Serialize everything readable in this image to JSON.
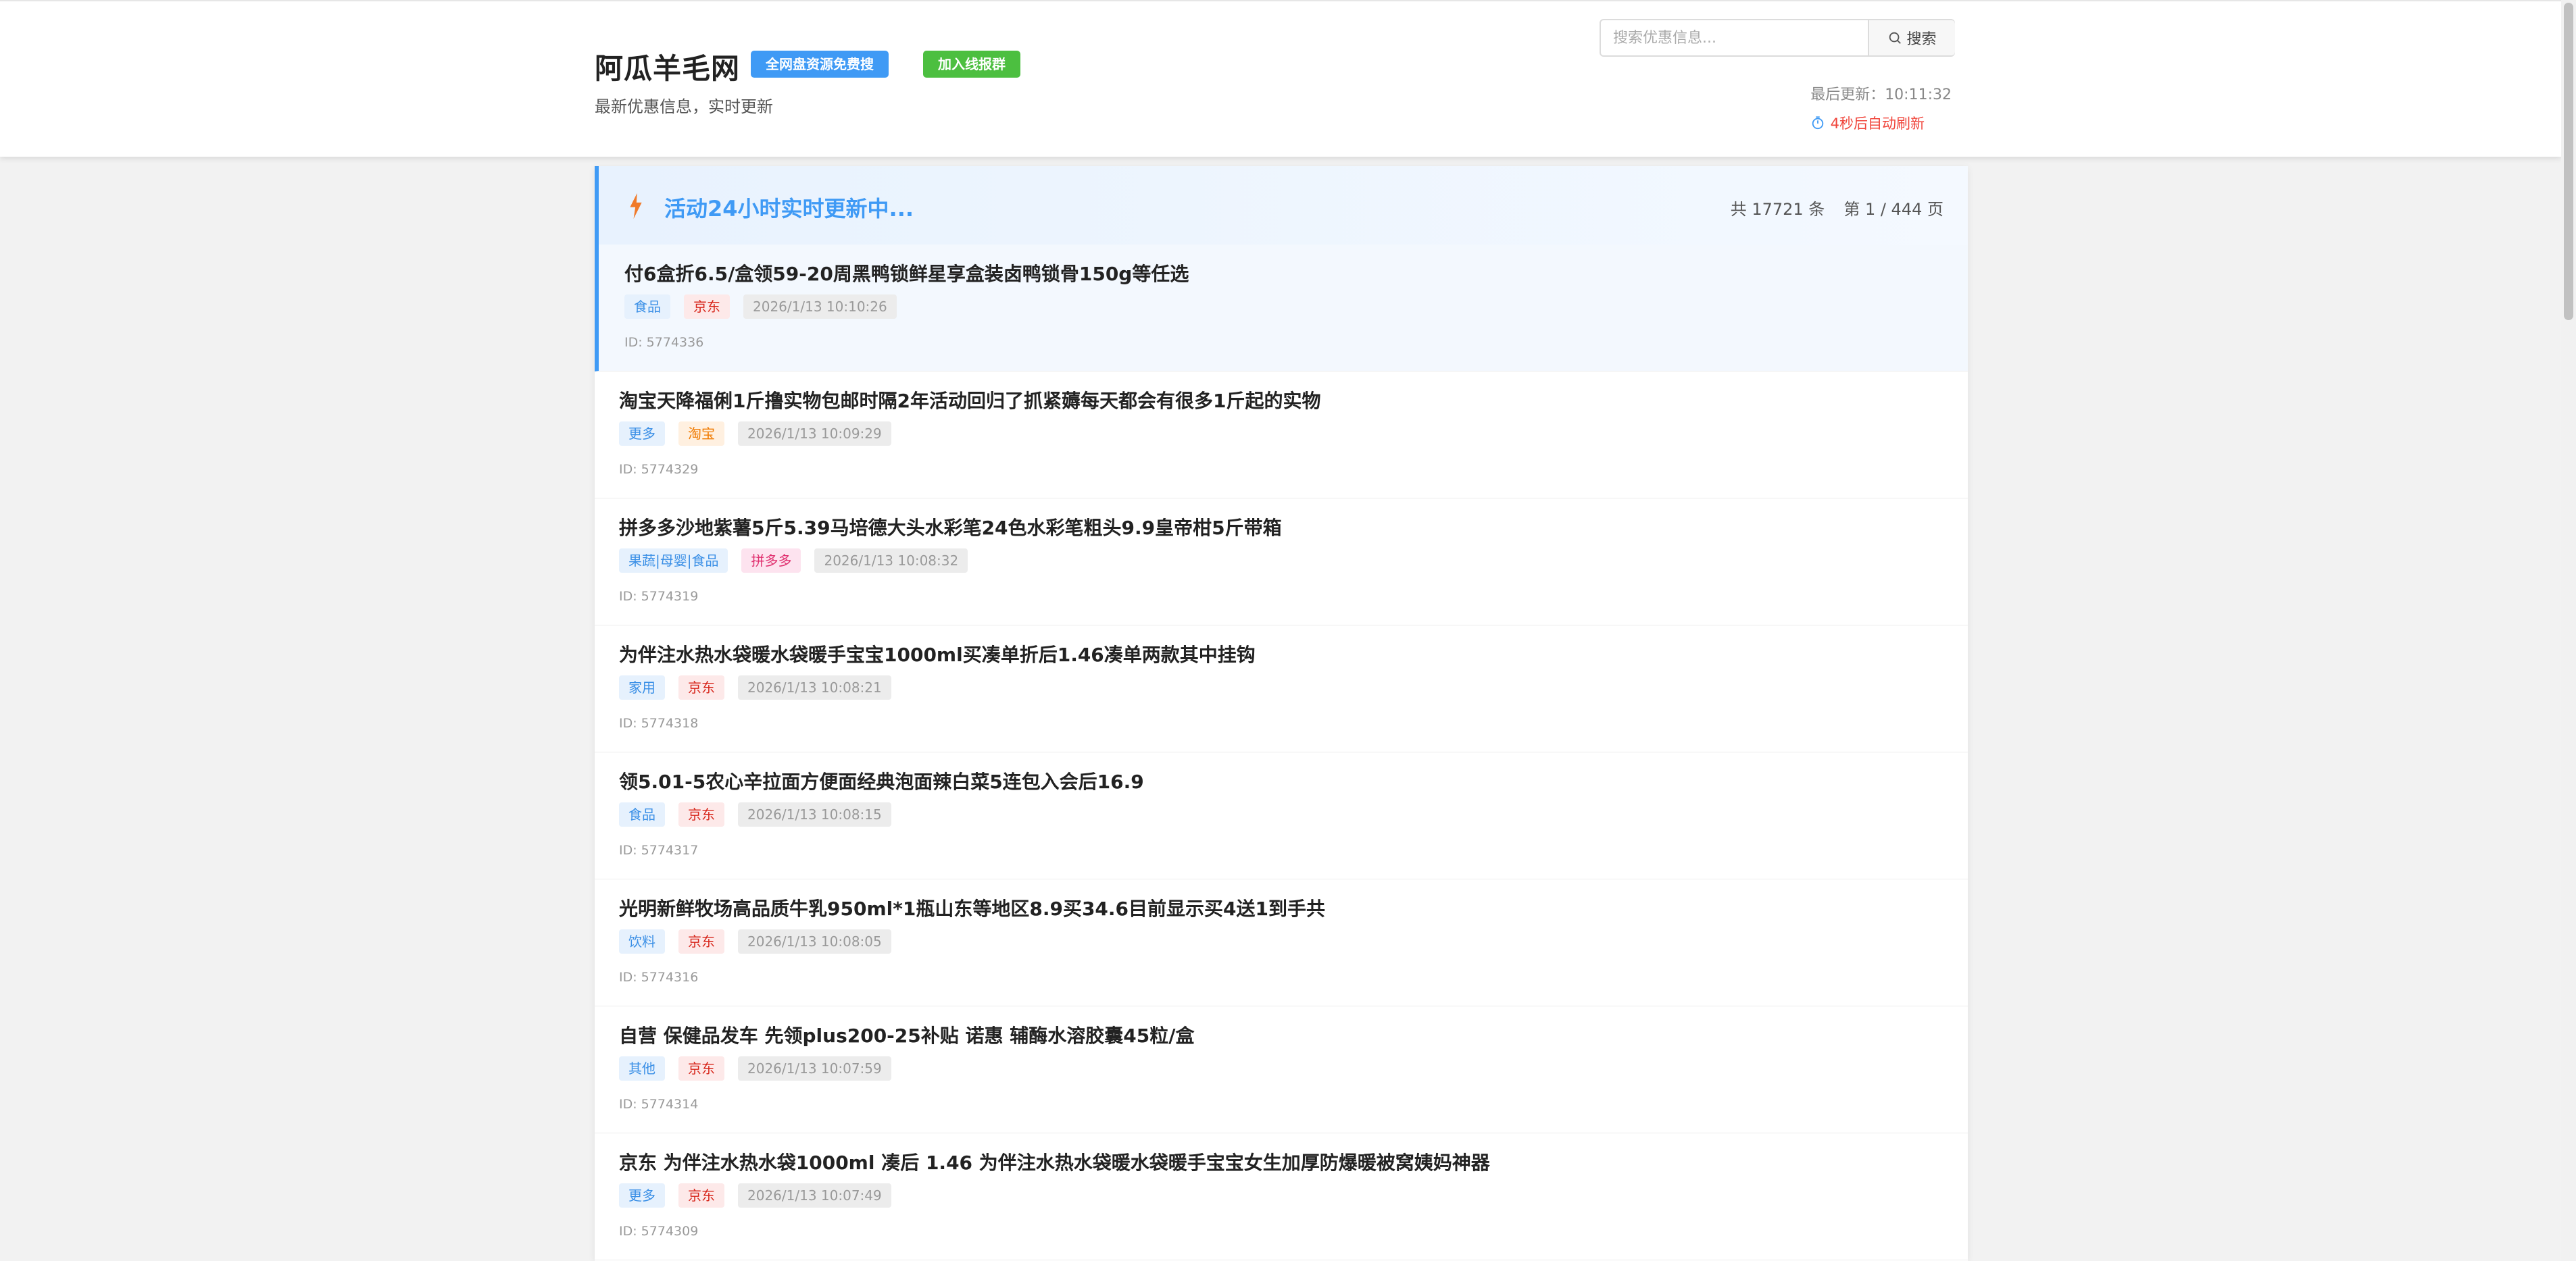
{
  "header": {
    "title": "阿瓜羊毛网",
    "badge_search": "全网盘资源免费搜",
    "badge_group": "加入线报群",
    "subtitle": "最新优惠信息，实时更新",
    "search_placeholder": "搜索优惠信息...",
    "search_button": "搜索",
    "last_updated": "最后更新：10:11:32",
    "auto_refresh": "4秒后自动刷新"
  },
  "list": {
    "title": "活动24小时实时更新中...",
    "total": "共 17721 条",
    "page": "第 1 / 444 页"
  },
  "items": [
    {
      "title": "付6盒折6.5/盒领59-20周黑鸭锁鲜星享盒装卤鸭锁骨150g等任选",
      "category": "食品",
      "platform": "京东",
      "time": "2026/1/13 10:10:26",
      "id": "ID: 5774336"
    },
    {
      "title": "淘宝天降福俐1斤撸实物包邮时隔2年活动回归了抓紧薅每天都会有很多1斤起的实物",
      "category": "更多",
      "platform": "淘宝",
      "time": "2026/1/13 10:09:29",
      "id": "ID: 5774329"
    },
    {
      "title": "拼多多沙地紫薯5斤5.39马培德大头水彩笔24色水彩笔粗头9.9皇帝柑5斤带箱",
      "category": "果蔬|母婴|食品",
      "platform": "拼多多",
      "time": "2026/1/13 10:08:32",
      "id": "ID: 5774319"
    },
    {
      "title": "为伴注水热水袋暖水袋暖手宝宝1000ml买凑单折后1.46凑单两款其中挂钩",
      "category": "家用",
      "platform": "京东",
      "time": "2026/1/13 10:08:21",
      "id": "ID: 5774318"
    },
    {
      "title": "领5.01-5农心辛拉面方便面经典泡面辣白菜5连包入会后16.9",
      "category": "食品",
      "platform": "京东",
      "time": "2026/1/13 10:08:15",
      "id": "ID: 5774317"
    },
    {
      "title": "光明新鲜牧场高品质牛乳950ml*1瓶山东等地区8.9买34.6目前显示买4送1到手共",
      "category": "饮料",
      "platform": "京东",
      "time": "2026/1/13 10:08:05",
      "id": "ID: 5774316"
    },
    {
      "title": "自营 保健品发车 先领plus200-25补贴 诺惠 辅酶水溶胶囊45粒/盒",
      "category": "其他",
      "platform": "京东",
      "time": "2026/1/13 10:07:59",
      "id": "ID: 5774314"
    },
    {
      "title": "京东 为伴注水热水袋1000ml 凑后 1.46 为伴注水热水袋暖水袋暖手宝宝女生加厚防爆暖被窝姨妈神器",
      "category": "更多",
      "platform": "京东",
      "time": "2026/1/13 10:07:49",
      "id": "ID: 5774309"
    }
  ],
  "colors": {
    "accent": "#3f9af5",
    "green": "#4cbf40",
    "refresh_red": "#f0443a"
  }
}
